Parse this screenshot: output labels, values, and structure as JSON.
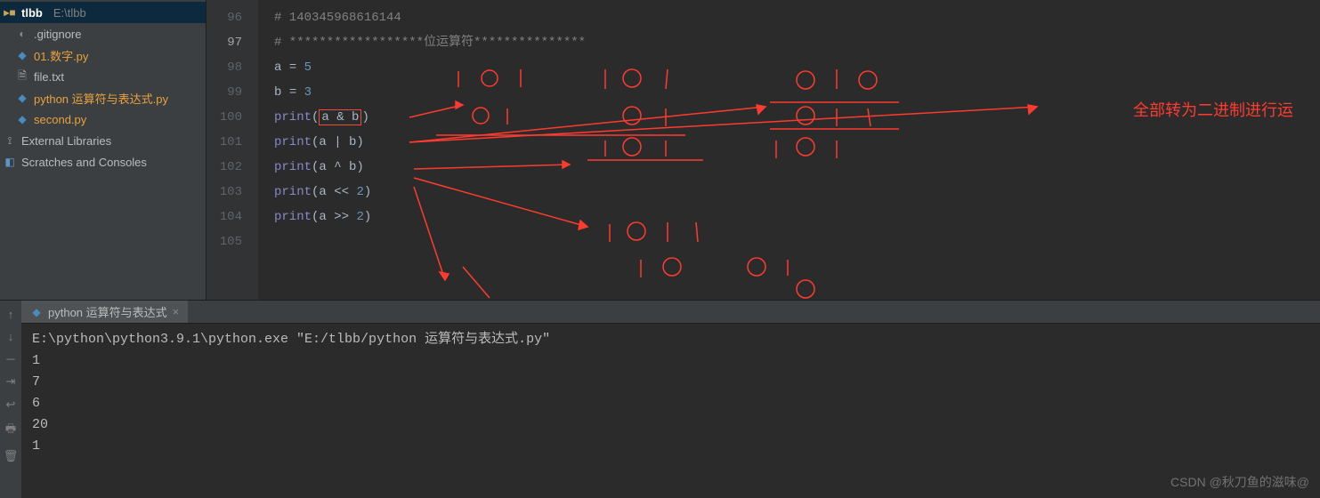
{
  "project": {
    "name": "tlbb",
    "path": "E:\\tlbb",
    "files": [
      {
        "name": ".gitignore",
        "icon": "git"
      },
      {
        "name": "01.数字.py",
        "icon": "py",
        "active": true
      },
      {
        "name": "file.txt",
        "icon": "file"
      },
      {
        "name": "python 运算符与表达式.py",
        "icon": "py",
        "active": true
      },
      {
        "name": "second.py",
        "icon": "py",
        "active": true
      }
    ],
    "extLibs": "External Libraries",
    "scratches": "Scratches and Consoles"
  },
  "editor": {
    "lineStart": 96,
    "currentLine": 97,
    "lines": [
      {
        "n": 96,
        "tokens": [
          {
            "t": "comment",
            "v": "# 140345968616144"
          }
        ]
      },
      {
        "n": 97,
        "tokens": [
          {
            "t": "comment",
            "v": "# ******************位运算符***************"
          }
        ]
      },
      {
        "n": 98,
        "tokens": [
          {
            "t": "op",
            "v": "a "
          },
          {
            "t": "op",
            "v": "= "
          },
          {
            "t": "num",
            "v": "5"
          }
        ]
      },
      {
        "n": 99,
        "tokens": [
          {
            "t": "op",
            "v": "b "
          },
          {
            "t": "op",
            "v": "= "
          },
          {
            "t": "num",
            "v": "3"
          }
        ]
      },
      {
        "n": 100,
        "tokens": [
          {
            "t": "fn",
            "v": "print"
          },
          {
            "t": "op",
            "v": "("
          },
          {
            "t": "box",
            "v": "a & b"
          },
          {
            "t": "op",
            "v": ")"
          }
        ]
      },
      {
        "n": 101,
        "tokens": [
          {
            "t": "fn",
            "v": "print"
          },
          {
            "t": "op",
            "v": "(a | b)"
          }
        ]
      },
      {
        "n": 102,
        "tokens": [
          {
            "t": "fn",
            "v": "print"
          },
          {
            "t": "op",
            "v": "(a ^ b)"
          }
        ]
      },
      {
        "n": 103,
        "tokens": [
          {
            "t": "fn",
            "v": "print"
          },
          {
            "t": "op",
            "v": "(a << "
          },
          {
            "t": "num",
            "v": "2"
          },
          {
            "t": "op",
            "v": ")"
          }
        ]
      },
      {
        "n": 104,
        "tokens": [
          {
            "t": "fn",
            "v": "print"
          },
          {
            "t": "op",
            "v": "(a >> "
          },
          {
            "t": "num",
            "v": "2"
          },
          {
            "t": "op",
            "v": ")"
          }
        ]
      },
      {
        "n": 105,
        "tokens": []
      }
    ]
  },
  "annotations": {
    "note": "全部转为二进制进行运"
  },
  "runTab": {
    "label": "python 运算符与表达式",
    "icon": "py"
  },
  "console": {
    "cmd": "E:\\python\\python3.9.1\\python.exe \"E:/tlbb/python 运算符与表达式.py\"",
    "out": [
      "1",
      "7",
      "6",
      "20",
      "1"
    ]
  },
  "toolIcons": [
    "arrow-up",
    "arrow-down",
    "divider",
    "filter",
    "wrap",
    "print",
    "trash"
  ],
  "watermark": "CSDN @秋刀鱼的滋味@"
}
